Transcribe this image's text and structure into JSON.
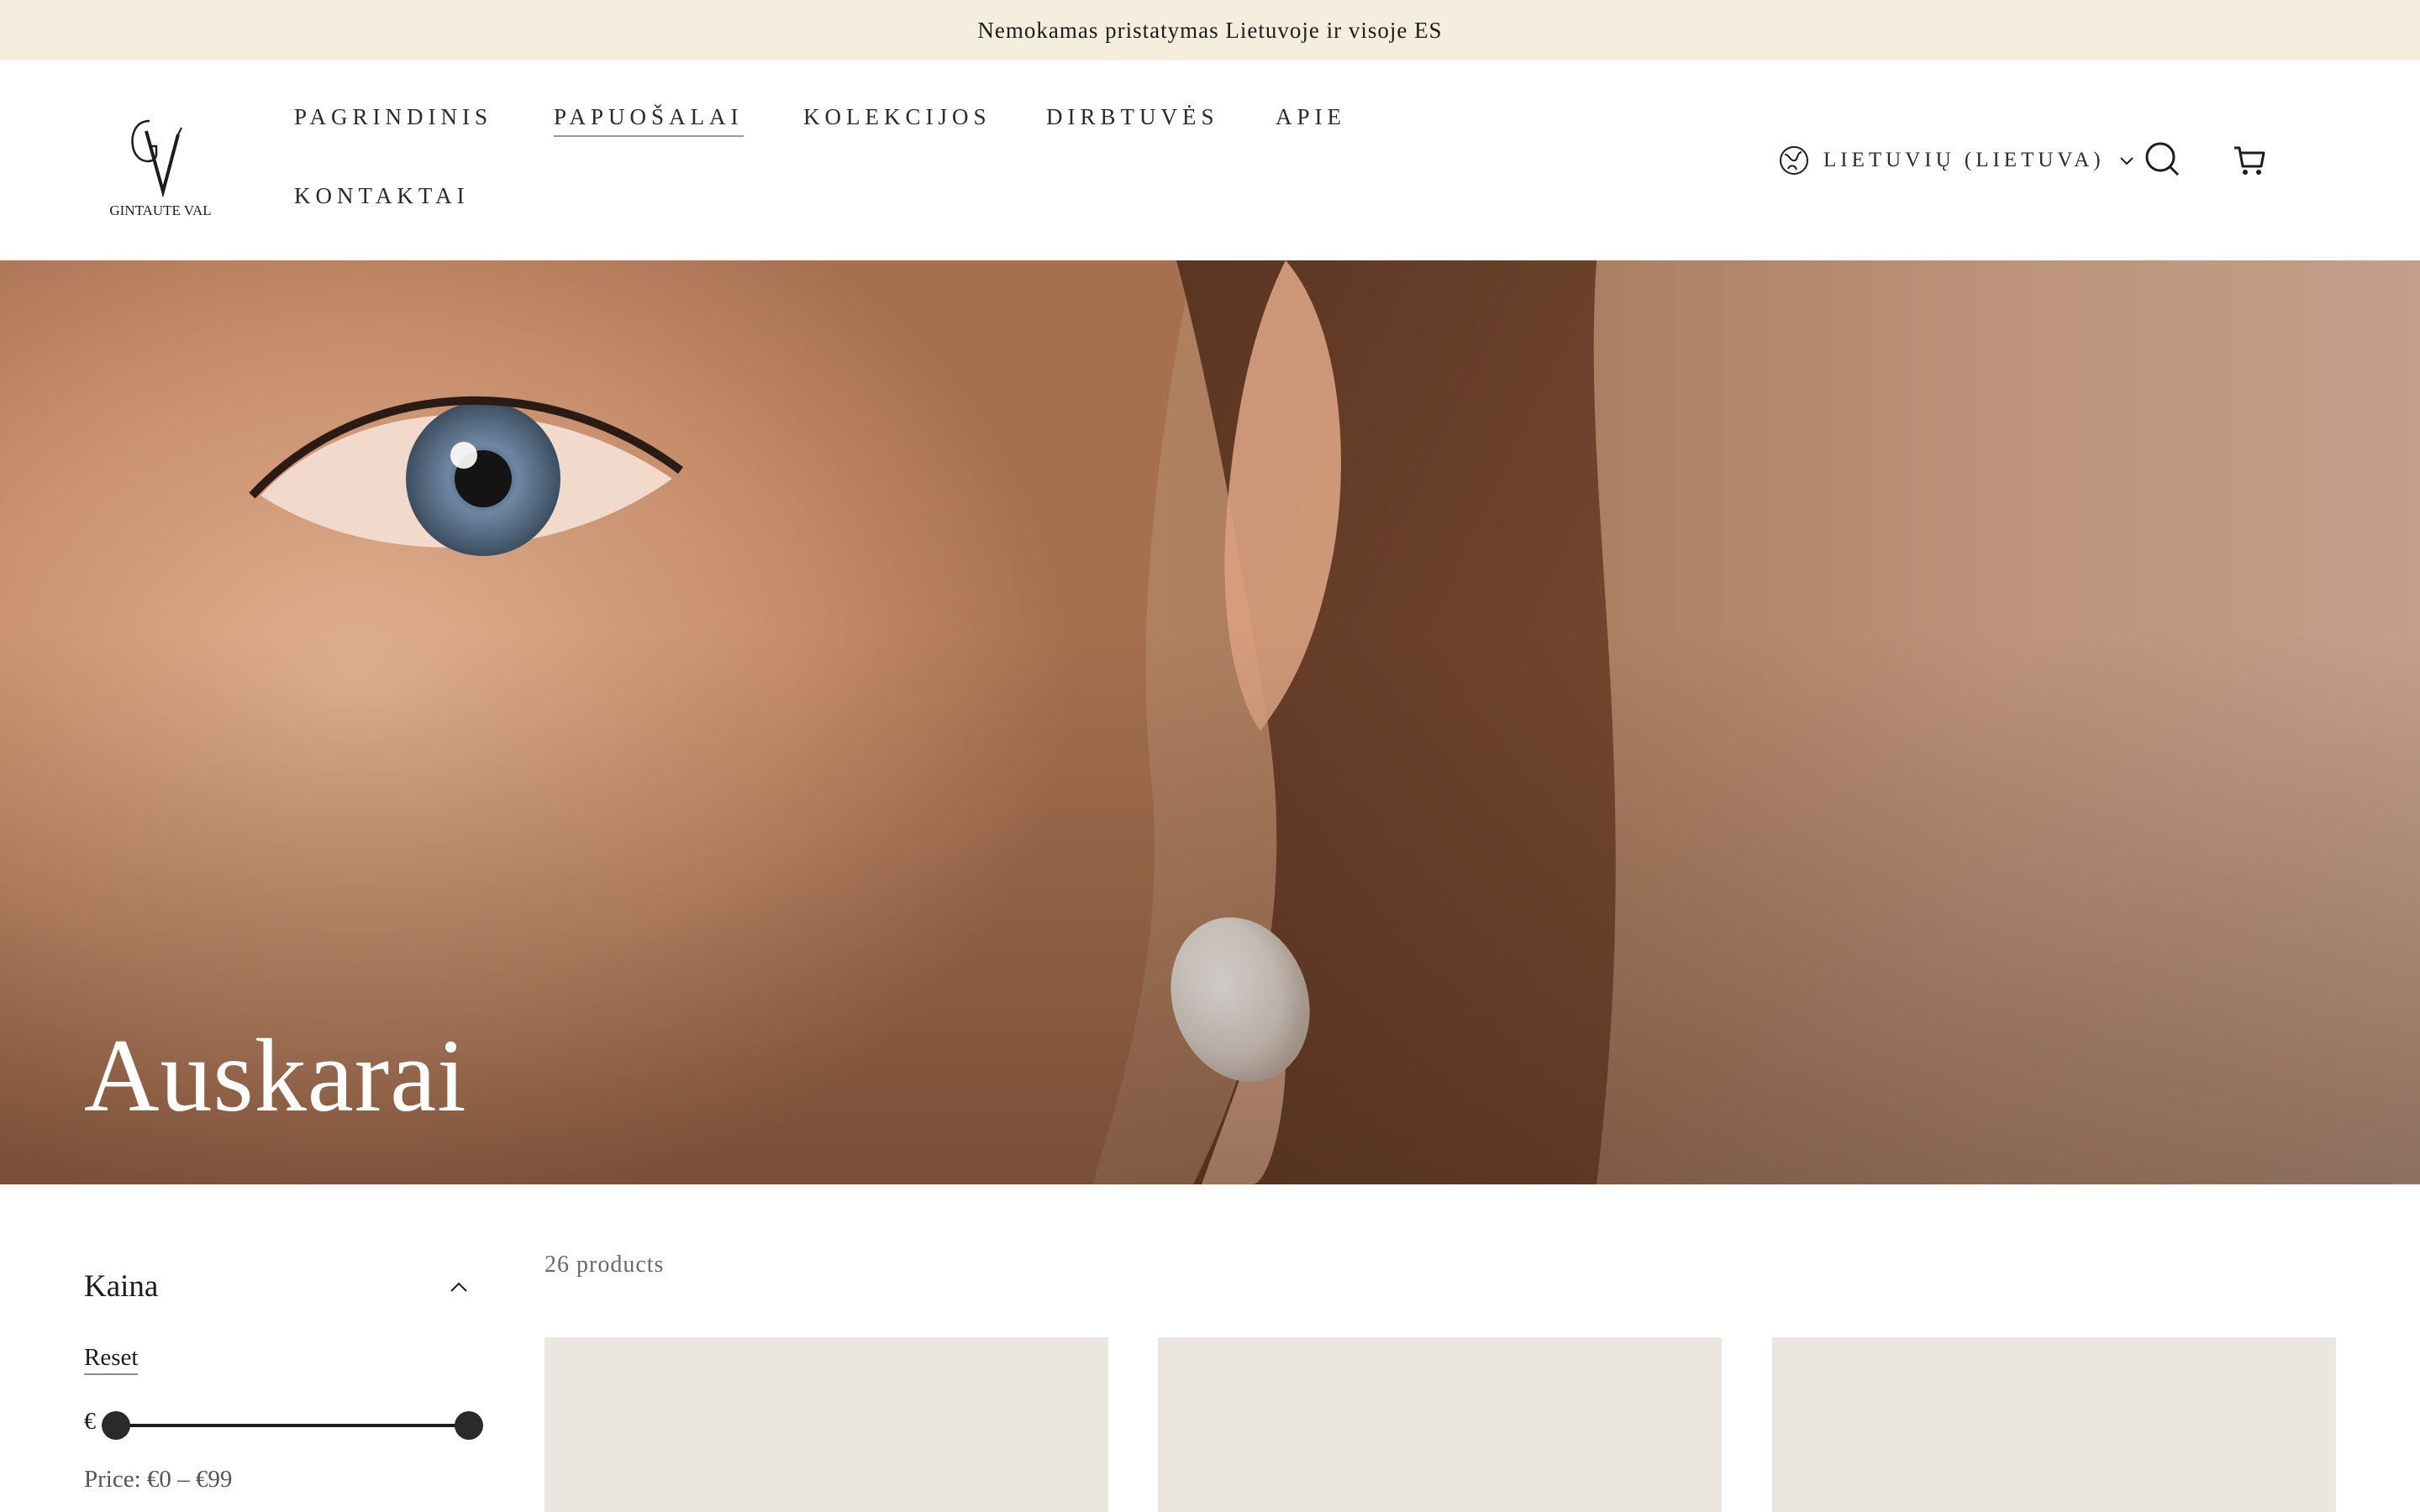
{
  "announcement": "Nemokamas pristatymas Lietuvoje ir visoje ES",
  "brand": {
    "name": "GINTAUTE VAL",
    "monogram": "GV"
  },
  "nav": {
    "items": [
      {
        "label": "PAGRINDINIS"
      },
      {
        "label": "PAPUOŠALAI",
        "active": true
      },
      {
        "label": "KOLEKCIJOS"
      },
      {
        "label": "DIRBTUVĖS"
      },
      {
        "label": "APIE"
      },
      {
        "label": "KONTAKTAI"
      }
    ]
  },
  "locale": {
    "label": "LIETUVIŲ (LIETUVA)",
    "icon": "globe-icon"
  },
  "header_icons": [
    "search-icon",
    "cart-icon"
  ],
  "hero": {
    "title": "Auskarai"
  },
  "filters": {
    "price": {
      "title": "Kaina",
      "reset_label": "Reset",
      "currency": "€",
      "range_text": "Price: €0 – €99",
      "min_value": 0,
      "max_value": 99
    }
  },
  "products": {
    "count_label": "26 products",
    "visible_cards": 3
  },
  "colors": {
    "announcement_bg": "#f5eddd",
    "card_bg": "#ebe6e0",
    "text": "#1c1c1c"
  }
}
